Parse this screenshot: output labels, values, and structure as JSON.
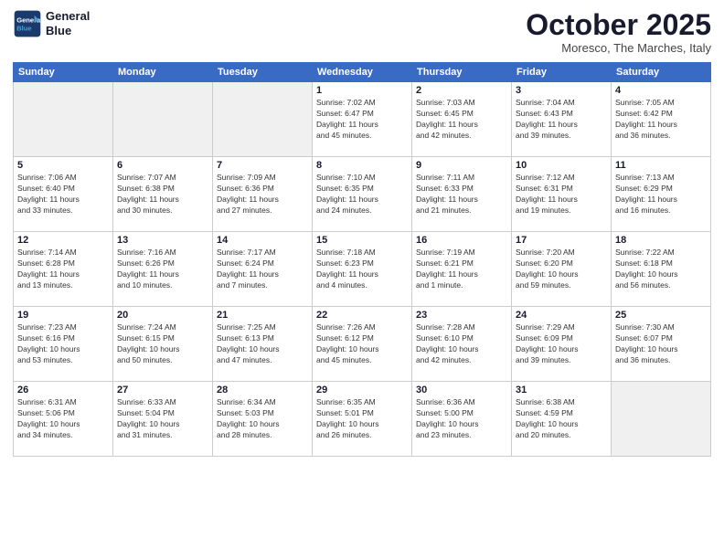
{
  "header": {
    "logo_line1": "General",
    "logo_line2": "Blue",
    "month": "October 2025",
    "location": "Moresco, The Marches, Italy"
  },
  "weekdays": [
    "Sunday",
    "Monday",
    "Tuesday",
    "Wednesday",
    "Thursday",
    "Friday",
    "Saturday"
  ],
  "weeks": [
    [
      {
        "num": "",
        "detail": "",
        "empty": true
      },
      {
        "num": "",
        "detail": "",
        "empty": true
      },
      {
        "num": "",
        "detail": "",
        "empty": true
      },
      {
        "num": "1",
        "detail": "Sunrise: 7:02 AM\nSunset: 6:47 PM\nDaylight: 11 hours\nand 45 minutes."
      },
      {
        "num": "2",
        "detail": "Sunrise: 7:03 AM\nSunset: 6:45 PM\nDaylight: 11 hours\nand 42 minutes."
      },
      {
        "num": "3",
        "detail": "Sunrise: 7:04 AM\nSunset: 6:43 PM\nDaylight: 11 hours\nand 39 minutes."
      },
      {
        "num": "4",
        "detail": "Sunrise: 7:05 AM\nSunset: 6:42 PM\nDaylight: 11 hours\nand 36 minutes."
      }
    ],
    [
      {
        "num": "5",
        "detail": "Sunrise: 7:06 AM\nSunset: 6:40 PM\nDaylight: 11 hours\nand 33 minutes."
      },
      {
        "num": "6",
        "detail": "Sunrise: 7:07 AM\nSunset: 6:38 PM\nDaylight: 11 hours\nand 30 minutes."
      },
      {
        "num": "7",
        "detail": "Sunrise: 7:09 AM\nSunset: 6:36 PM\nDaylight: 11 hours\nand 27 minutes."
      },
      {
        "num": "8",
        "detail": "Sunrise: 7:10 AM\nSunset: 6:35 PM\nDaylight: 11 hours\nand 24 minutes."
      },
      {
        "num": "9",
        "detail": "Sunrise: 7:11 AM\nSunset: 6:33 PM\nDaylight: 11 hours\nand 21 minutes."
      },
      {
        "num": "10",
        "detail": "Sunrise: 7:12 AM\nSunset: 6:31 PM\nDaylight: 11 hours\nand 19 minutes."
      },
      {
        "num": "11",
        "detail": "Sunrise: 7:13 AM\nSunset: 6:29 PM\nDaylight: 11 hours\nand 16 minutes."
      }
    ],
    [
      {
        "num": "12",
        "detail": "Sunrise: 7:14 AM\nSunset: 6:28 PM\nDaylight: 11 hours\nand 13 minutes."
      },
      {
        "num": "13",
        "detail": "Sunrise: 7:16 AM\nSunset: 6:26 PM\nDaylight: 11 hours\nand 10 minutes."
      },
      {
        "num": "14",
        "detail": "Sunrise: 7:17 AM\nSunset: 6:24 PM\nDaylight: 11 hours\nand 7 minutes."
      },
      {
        "num": "15",
        "detail": "Sunrise: 7:18 AM\nSunset: 6:23 PM\nDaylight: 11 hours\nand 4 minutes."
      },
      {
        "num": "16",
        "detail": "Sunrise: 7:19 AM\nSunset: 6:21 PM\nDaylight: 11 hours\nand 1 minute."
      },
      {
        "num": "17",
        "detail": "Sunrise: 7:20 AM\nSunset: 6:20 PM\nDaylight: 10 hours\nand 59 minutes."
      },
      {
        "num": "18",
        "detail": "Sunrise: 7:22 AM\nSunset: 6:18 PM\nDaylight: 10 hours\nand 56 minutes."
      }
    ],
    [
      {
        "num": "19",
        "detail": "Sunrise: 7:23 AM\nSunset: 6:16 PM\nDaylight: 10 hours\nand 53 minutes."
      },
      {
        "num": "20",
        "detail": "Sunrise: 7:24 AM\nSunset: 6:15 PM\nDaylight: 10 hours\nand 50 minutes."
      },
      {
        "num": "21",
        "detail": "Sunrise: 7:25 AM\nSunset: 6:13 PM\nDaylight: 10 hours\nand 47 minutes."
      },
      {
        "num": "22",
        "detail": "Sunrise: 7:26 AM\nSunset: 6:12 PM\nDaylight: 10 hours\nand 45 minutes."
      },
      {
        "num": "23",
        "detail": "Sunrise: 7:28 AM\nSunset: 6:10 PM\nDaylight: 10 hours\nand 42 minutes."
      },
      {
        "num": "24",
        "detail": "Sunrise: 7:29 AM\nSunset: 6:09 PM\nDaylight: 10 hours\nand 39 minutes."
      },
      {
        "num": "25",
        "detail": "Sunrise: 7:30 AM\nSunset: 6:07 PM\nDaylight: 10 hours\nand 36 minutes."
      }
    ],
    [
      {
        "num": "26",
        "detail": "Sunrise: 6:31 AM\nSunset: 5:06 PM\nDaylight: 10 hours\nand 34 minutes."
      },
      {
        "num": "27",
        "detail": "Sunrise: 6:33 AM\nSunset: 5:04 PM\nDaylight: 10 hours\nand 31 minutes."
      },
      {
        "num": "28",
        "detail": "Sunrise: 6:34 AM\nSunset: 5:03 PM\nDaylight: 10 hours\nand 28 minutes."
      },
      {
        "num": "29",
        "detail": "Sunrise: 6:35 AM\nSunset: 5:01 PM\nDaylight: 10 hours\nand 26 minutes."
      },
      {
        "num": "30",
        "detail": "Sunrise: 6:36 AM\nSunset: 5:00 PM\nDaylight: 10 hours\nand 23 minutes."
      },
      {
        "num": "31",
        "detail": "Sunrise: 6:38 AM\nSunset: 4:59 PM\nDaylight: 10 hours\nand 20 minutes."
      },
      {
        "num": "",
        "detail": "",
        "empty": true
      }
    ]
  ]
}
